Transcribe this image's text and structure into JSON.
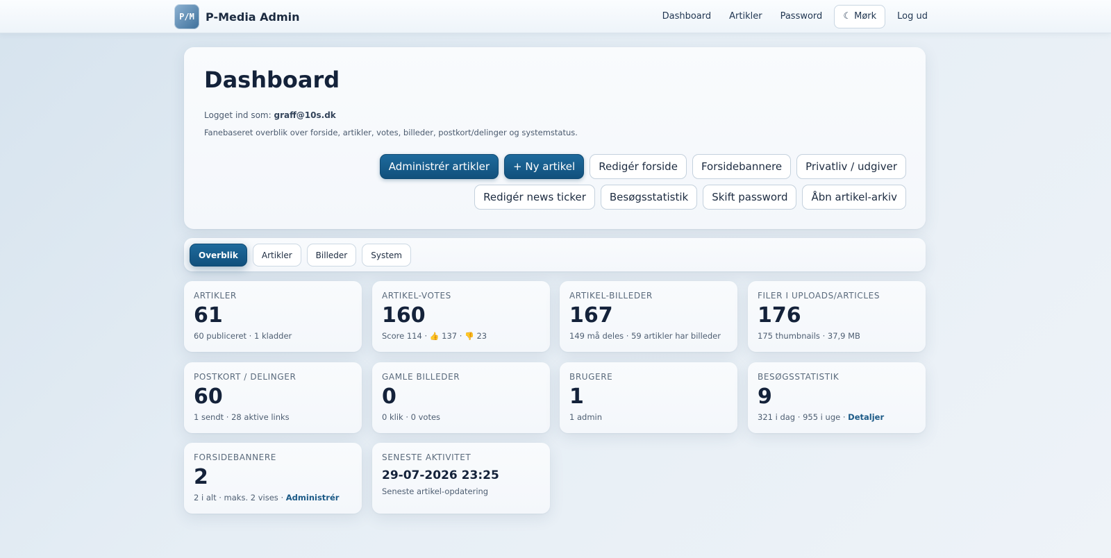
{
  "brand": {
    "logo_text": "P/M",
    "name": "P-Media Admin"
  },
  "nav": {
    "dashboard": "Dashboard",
    "articles": "Artikler",
    "password": "Password",
    "theme": "☾ Mørk",
    "logout": "Log ud"
  },
  "header": {
    "title": "Dashboard",
    "login_prefix": "Logget ind som:",
    "login_user": "graff@10s.dk",
    "description": "Fanebaseret overblik over forside, artikler, votes, billeder, postkort/delinger og systemstatus."
  },
  "actions": {
    "manage_articles": "Administrér artikler",
    "new_article": "+ Ny artikel",
    "edit_frontpage": "Redigér forside",
    "frontpage_banners": "Forsidebannere",
    "privacy": "Privatliv / udgiver",
    "edit_ticker": "Redigér news ticker",
    "visit_stats": "Besøgsstatistik",
    "change_password": "Skift password",
    "open_archive": "Åbn artikel-arkiv"
  },
  "tabs": {
    "overview": "Overblik",
    "articles": "Artikler",
    "images": "Billeder",
    "system": "System"
  },
  "stats": {
    "articles": {
      "label": "Artikler",
      "value": "61",
      "sub": "60 publiceret · 1 kladder"
    },
    "votes": {
      "label": "Artikel-votes",
      "value": "160",
      "sub_score": "Score 114 ·",
      "up_icon": "👍",
      "up": "137 ·",
      "down_icon": "👎",
      "down": "23"
    },
    "article_images": {
      "label": "Artikel-billeder",
      "value": "167",
      "sub": "149 må deles · 59 artikler har billeder"
    },
    "uploads": {
      "label": "Filer i uploads/articles",
      "value": "176",
      "sub": "175 thumbnails · 37,9 MB"
    },
    "postcards": {
      "label": "Postkort / delinger",
      "value": "60",
      "sub": "1 sendt · 28 aktive links"
    },
    "old_images": {
      "label": "Gamle billeder",
      "value": "0",
      "sub": "0 klik · 0 votes"
    },
    "users": {
      "label": "Brugere",
      "value": "1",
      "sub": "1 admin"
    },
    "visits": {
      "label": "Besøgsstatistik",
      "value": "9",
      "sub": "321 i dag · 955 i uge ·",
      "link": "Detaljer"
    },
    "banners": {
      "label": "Forsidebannere",
      "value": "2",
      "sub": "2 i alt · maks. 2 vises ·",
      "link": "Administrér"
    },
    "latest": {
      "label": "Seneste aktivitet",
      "value": "29-07-2026 23:25",
      "sub": "Seneste artikel-opdatering"
    }
  }
}
